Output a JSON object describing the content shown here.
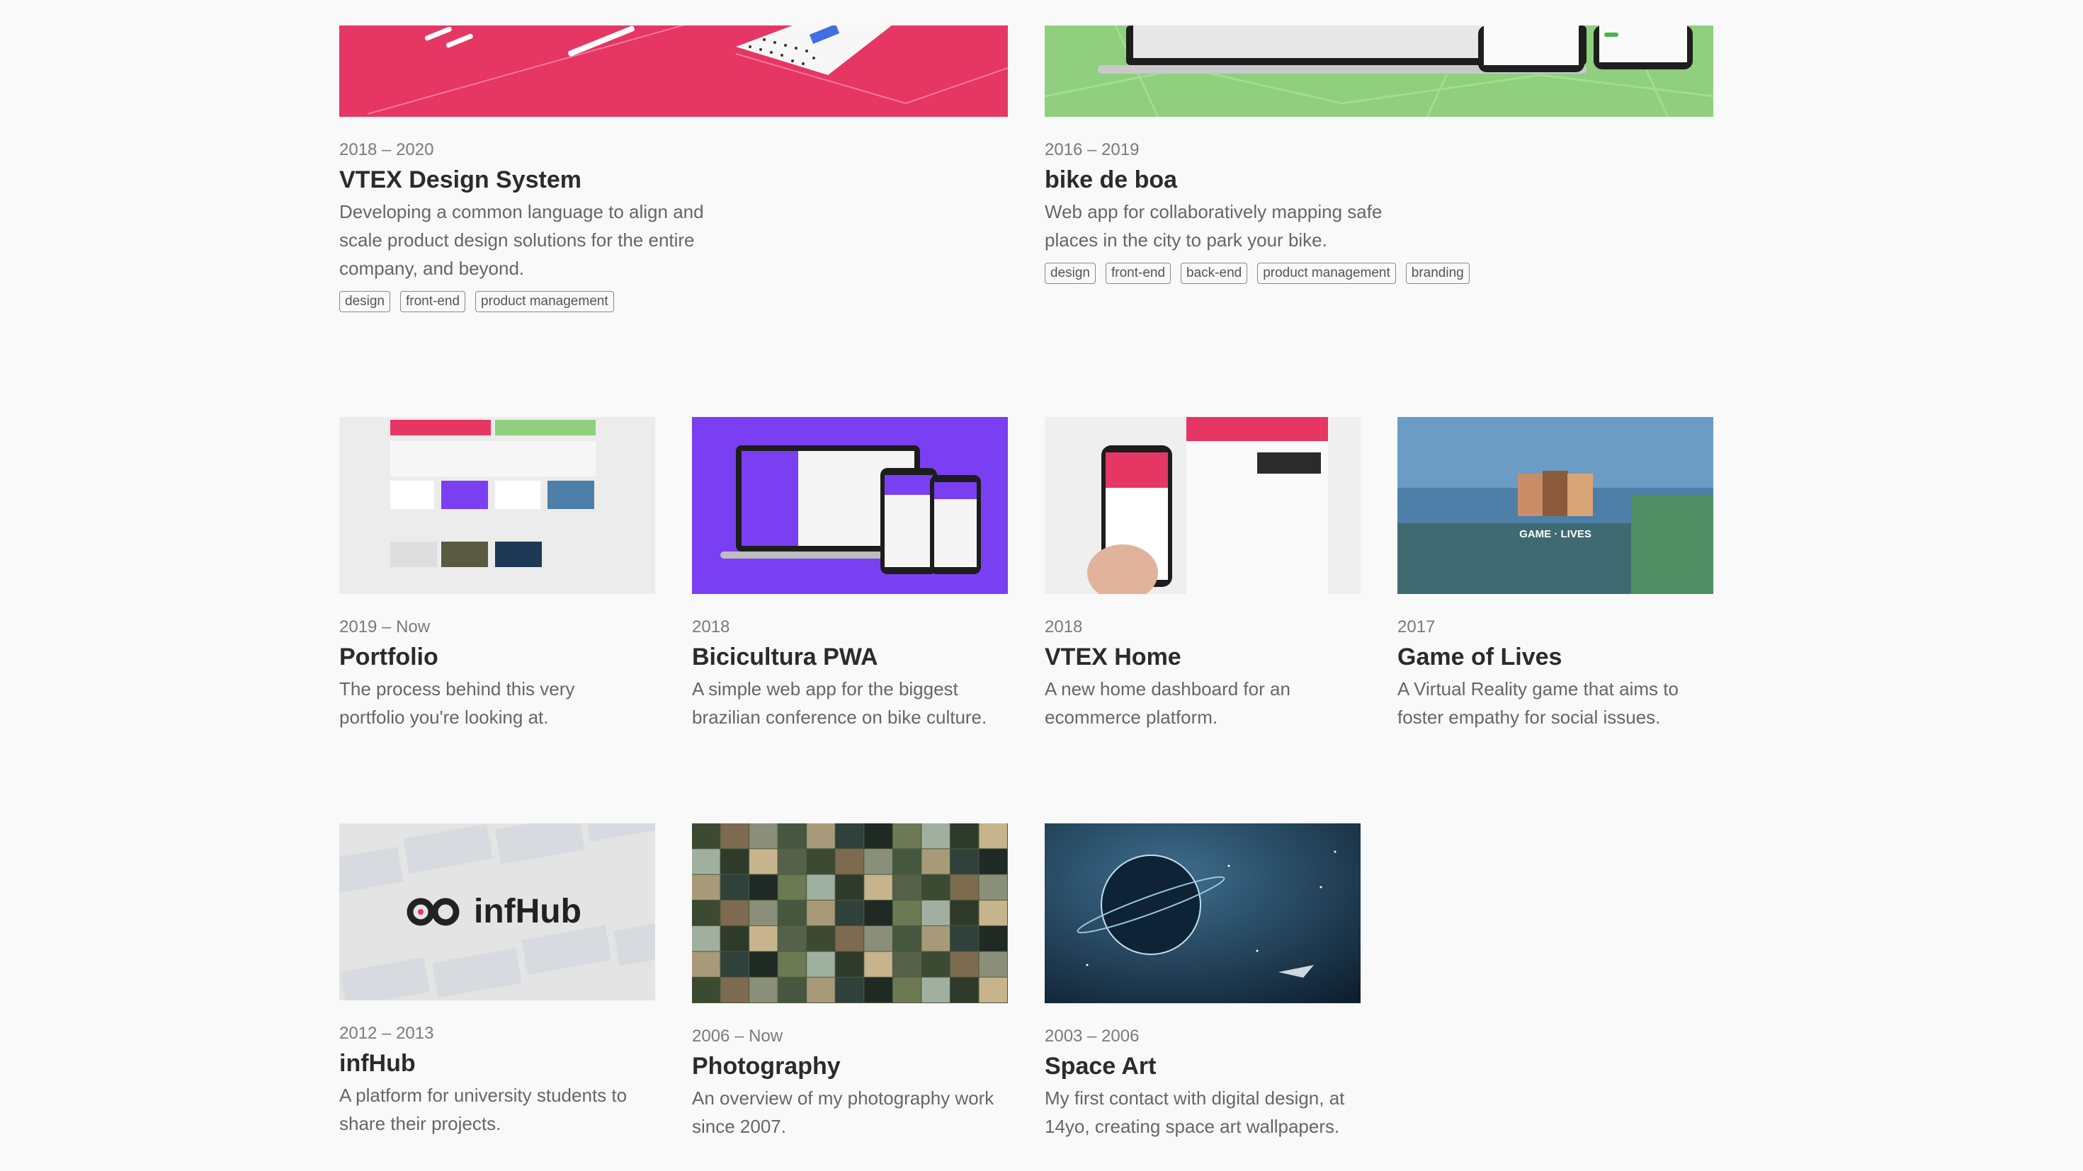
{
  "projects_featured": [
    {
      "period": "2018 – 2020",
      "title": "VTEX Design System",
      "description": "Developing a common language to align and scale product design solutions for the entire company, and beyond.",
      "tags": [
        "design",
        "front-end",
        "product management"
      ],
      "thumb_color": "#e63663"
    },
    {
      "period": "2016 – 2019",
      "title": "bike de boa",
      "description": "Web app for collaboratively mapping safe places in the city to park your bike.",
      "tags": [
        "design",
        "front-end",
        "back-end",
        "product management",
        "branding"
      ],
      "thumb_color": "#8fcf7e"
    }
  ],
  "projects_grid": [
    {
      "period": "2019 – Now",
      "title": "Portfolio",
      "description": "The process behind this very portfolio you're looking at.",
      "thumb_color": "#ececec"
    },
    {
      "period": "2018",
      "title": "Bicicultura PWA",
      "description": "A simple web app for the biggest brazilian conference on bike culture.",
      "thumb_color": "#7a3ff2"
    },
    {
      "period": "2018",
      "title": "VTEX Home",
      "description": "A new home dashboard for an ecommerce platform.",
      "thumb_color": "#efefef"
    },
    {
      "period": "2017",
      "title": "Game of Lives",
      "description": "A Virtual Reality game that aims to foster empathy for social issues.",
      "thumb_color": "#4d7fa8",
      "thumb_logo_text": "GAME LIVES"
    },
    {
      "period": "2012 – 2013",
      "title": "infHub",
      "description": "A platform for university students to share their projects.",
      "thumb_color": "#e4e4e4",
      "thumb_logo_text": "infHub"
    },
    {
      "period": "2006 – Now",
      "title": "Photography",
      "description": "An overview of my photography work since 2007.",
      "thumb_color": "#4a5a3c"
    },
    {
      "period": "2003 – 2006",
      "title": "Space Art",
      "description": "My first contact with digital design, at 14yo, creating space art wallpapers.",
      "thumb_color": "#1c3a55"
    }
  ]
}
